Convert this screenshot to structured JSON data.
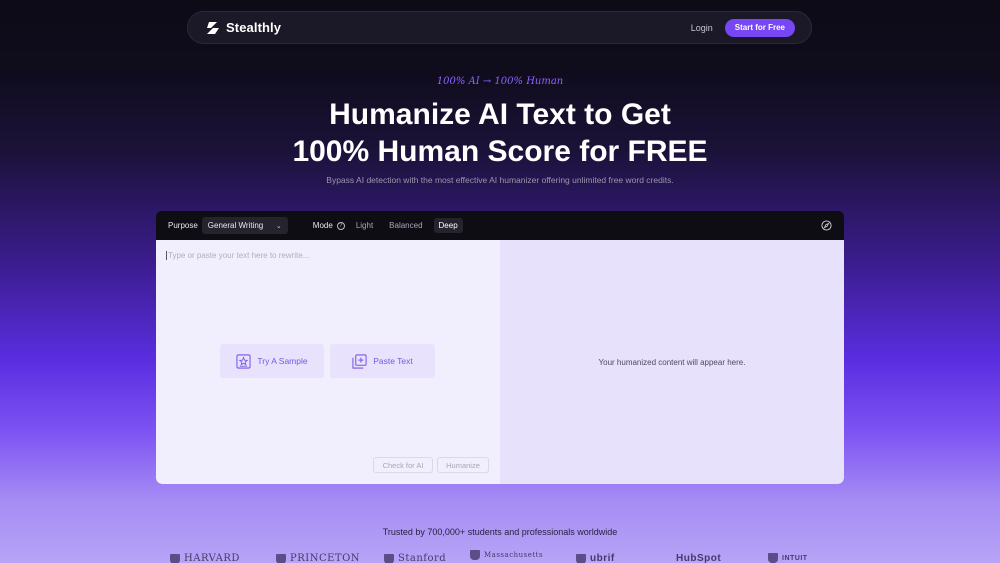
{
  "nav": {
    "brand": "Stealthly",
    "login_label": "Login",
    "cta_label": "Start for Free"
  },
  "hero": {
    "tagline": "100% AI → 100% Human",
    "title_line1": "Humanize AI Text to Get",
    "title_line2": "100% Human Score for FREE",
    "subtitle": "Bypass AI detection with the most effective AI humanizer offering unlimited free word credits."
  },
  "tool": {
    "purpose_label": "Purpose",
    "purpose_value": "General Writing",
    "mode_label": "Mode",
    "modes": [
      "Light",
      "Balanced",
      "Deep"
    ],
    "active_mode": "Deep",
    "input_placeholder": "Type or paste your text here to rewrite...",
    "try_sample_label": "Try A Sample",
    "paste_text_label": "Paste Text",
    "check_ai_label": "Check for AI",
    "humanize_label": "Humanize",
    "output_placeholder": "Your humanized content will appear here."
  },
  "trusted": {
    "text": "Trusted by 700,000+ students and professionals worldwide",
    "logos": [
      "HARVARD",
      "PRINCETON",
      "Stanford",
      "Massachusetts",
      "ubrif",
      "HubSpot",
      "INTUIT"
    ]
  },
  "colors": {
    "accent": "#7747f5",
    "tagline": "#8d63ff",
    "input_bg": "#f1eefd",
    "output_bg": "#e7e1fb"
  }
}
